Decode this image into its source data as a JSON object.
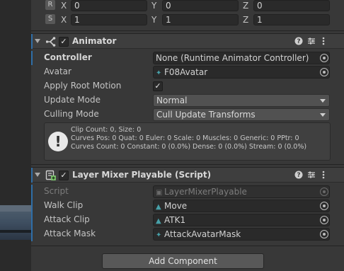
{
  "transform": {
    "rotation_row": {
      "button": "R",
      "x_label": "X",
      "x": "0",
      "y_label": "Y",
      "y": "0",
      "z_label": "Z",
      "z": "0"
    },
    "scale_row": {
      "button": "S",
      "x_label": "X",
      "x": "1",
      "y_label": "Y",
      "y": "1",
      "z_label": "Z",
      "z": "1"
    }
  },
  "animator": {
    "title": "Animator",
    "enabled_mark": "✓",
    "icons": [
      "animator-icon",
      "help-icon",
      "preset-icon",
      "more-menu-icon"
    ],
    "controller_label": "Controller",
    "controller_value": "None (Runtime Animator Controller)",
    "avatar_label": "Avatar",
    "avatar_value": "F08Avatar",
    "apply_root_motion_label": "Apply Root Motion",
    "apply_root_motion_mark": "✓",
    "update_mode_label": "Update Mode",
    "update_mode_value": "Normal",
    "culling_mode_label": "Culling Mode",
    "culling_mode_value": "Cull Update Transforms",
    "info_line1": "Clip Count: 0, Size: 0",
    "info_line2": "Curves Pos: 0 Quat: 0 Euler: 0 Scale: 0 Muscles: 0 Generic: 0 PPtr: 0",
    "info_line3": "Curves Count: 0 Constant: 0 (0.0%) Dense: 0 (0.0%) Stream: 0 (0.0%)",
    "info_icon": "!"
  },
  "layer_mixer": {
    "title": "Layer Mixer Playable (Script)",
    "enabled_mark": "✓",
    "script_label": "Script",
    "script_value": "LayerMixerPlayable",
    "walk_clip_label": "Walk Clip",
    "walk_clip_value": "Move",
    "attack_clip_label": "Attack Clip",
    "attack_clip_value": "ATK1",
    "attack_mask_label": "Attack Mask",
    "attack_mask_value": "AttackAvatarMask"
  },
  "add_component_label": "Add Component",
  "colors": {
    "accent": "#2f6ea7",
    "background": "#383838",
    "field": "#2a2a2a"
  }
}
